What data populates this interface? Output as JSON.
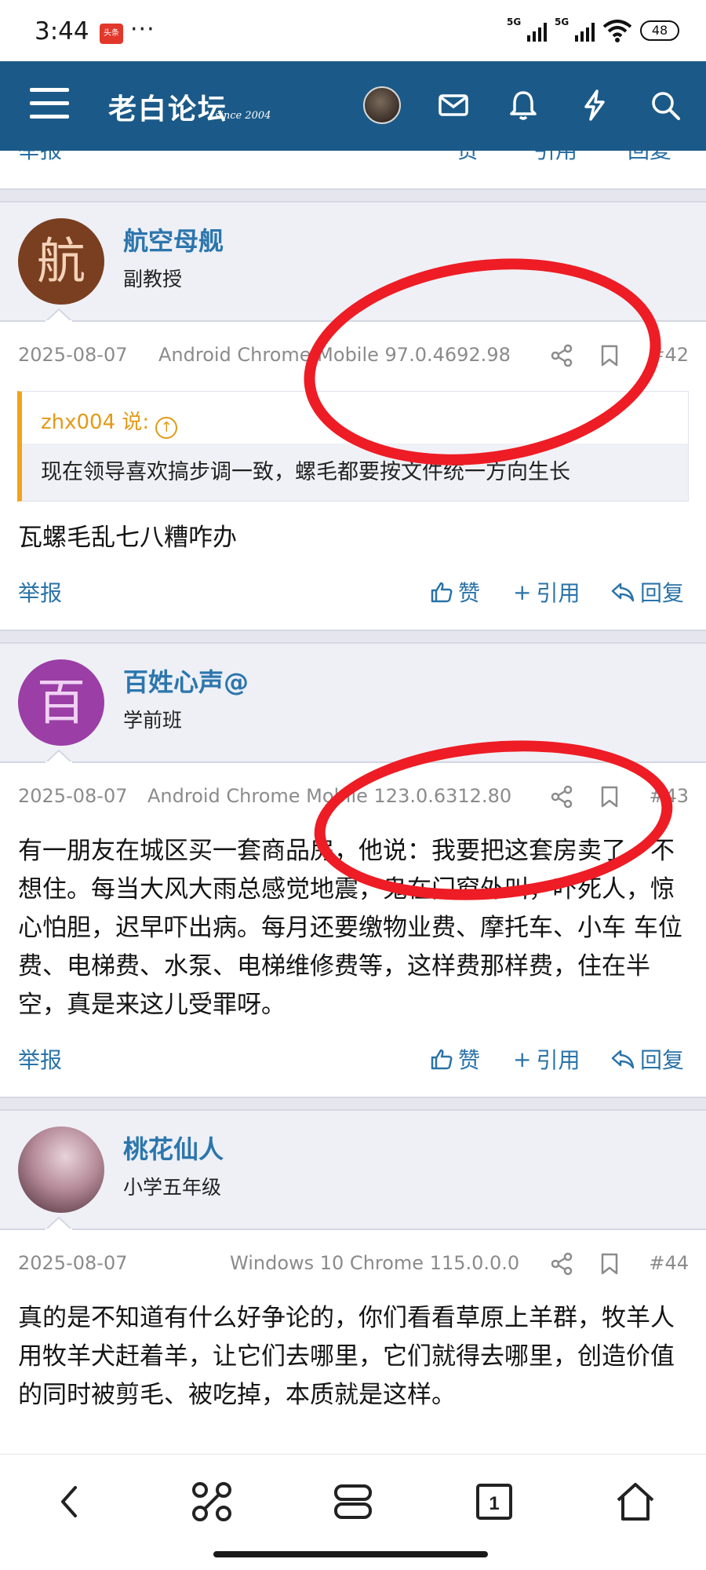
{
  "status_bar": {
    "time": "3:44",
    "app_badge": "头条",
    "dots": "···",
    "signal1": "5G",
    "signal2": "5G",
    "battery": "48"
  },
  "header": {
    "logo": "老白论坛",
    "logo_since": "since 2004"
  },
  "prev_actions": {
    "report": "举报",
    "like": "赞",
    "quote": "引用",
    "reply": "回复"
  },
  "posts": [
    {
      "avatar_char": "航",
      "avatar_color": "#7a3f20",
      "name": "航空母舰",
      "rank": "副教授",
      "date": "2025-08-07",
      "ua": "Android Chrome Mobile 97.0.4692.98",
      "num": "#42",
      "quote_author": "zhx004 说:",
      "quote_text": "现在领导喜欢搞步调一致，螺毛都要按文件统一方向生长",
      "text": "瓦螺毛乱七八糟咋办",
      "report": "举报",
      "like": "赞",
      "quote_btn": "引用",
      "reply": "回复"
    },
    {
      "avatar_char": "百",
      "avatar_color": "#9b3ea6",
      "name": "百姓心声@",
      "rank": "学前班",
      "date": "2025-08-07",
      "ua": "Android Chrome Mobile 123.0.6312.80",
      "num": "#43",
      "text": "有一朋友在城区买一套商品房，他说：我要把这套房卖了，不想住。每当大风大雨总感觉地震，鬼在门窗外叫，吓死人，惊心怕胆，迟早吓出病。每月还要缴物业费、摩托车、小车 车位费、电梯费、水泵、电梯维修费等，这样费那样费，住在半空，真是来这儿受罪呀。",
      "report": "举报",
      "like": "赞",
      "quote_btn": "引用",
      "reply": "回复"
    },
    {
      "avatar_char": "",
      "avatar_color": "#c7a7b3",
      "name": "桃花仙人",
      "rank": "小学五年级",
      "date": "2025-08-07",
      "ua": "Windows 10 Chrome 115.0.0.0",
      "num": "#44",
      "text": "真的是不知道有什么好争论的，你们看看草原上羊群，牧羊人用牧羊犬赶着羊，让它们去哪里，它们就得去哪里，创造价值的同时被剪毛、被吃掉，本质就是这样。"
    }
  ],
  "colors": {
    "header_bg": "#1b5a88",
    "link": "#2a73a8",
    "quote_accent": "#f2a31b",
    "annotation": "#ee1c24"
  }
}
